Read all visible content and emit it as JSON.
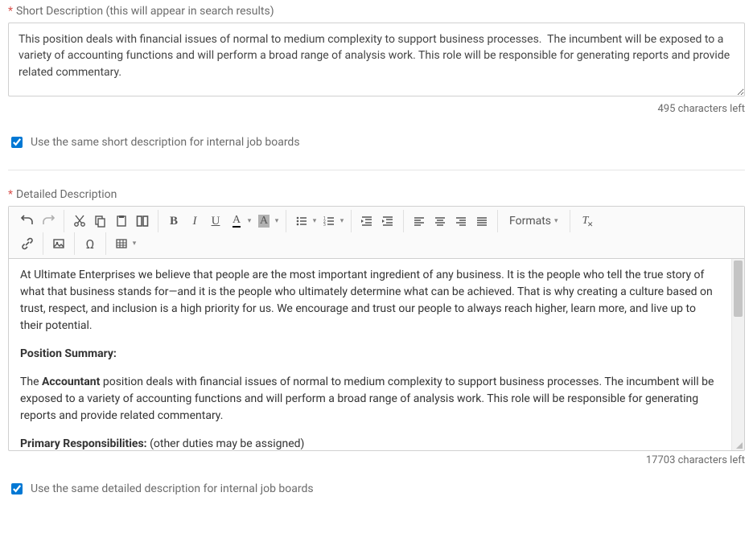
{
  "short_description": {
    "label": "Short Description (this will appear in search results)",
    "value": "This position deals with financial issues of normal to medium complexity to support business processes.  The incumbent will be exposed to a variety of accounting functions and will perform a broad range of analysis work. This role will be responsible for generating reports and provide related commentary.",
    "chars_left": "495 characters left"
  },
  "checkbox_short": {
    "label": "Use the same short description for internal job boards"
  },
  "detailed": {
    "label": "Detailed Description",
    "chars_left": "17703 characters left",
    "formats_label": "Formats",
    "intro": "At Ultimate Enterprises we believe that people are the most important ingredient of any business. It is the people who tell the true story of what that business stands for—and it is the people who ultimately determine what can be achieved. That is why creating a culture based on trust, respect, and inclusion is a high priority for us. We encourage and trust our people to always reach higher, learn more, and live up to their potential.",
    "position_summary_heading": "Position Summary:",
    "summary_prefix": "The ",
    "summary_role": "Accountant",
    "summary_rest": " position deals with financial issues of normal to medium complexity to support business processes.  The incumbent will be exposed to a variety of accounting functions and will perform a broad range of analysis work. This role will be responsible for generating reports and provide related commentary.",
    "responsibilities_heading": "Primary Responsibilities:",
    "responsibilities_note": " (other duties may be assigned)"
  },
  "checkbox_detailed": {
    "label": "Use the same detailed description for internal job boards"
  }
}
